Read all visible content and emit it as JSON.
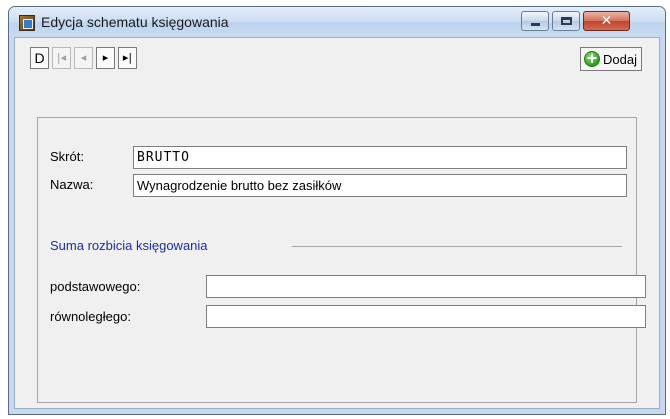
{
  "window": {
    "title": "Edycja schematu księgowania",
    "icon": "app-icon",
    "caption_buttons": {
      "minimize": "minimize-icon",
      "maximize": "maximize-icon",
      "close": "close-icon",
      "close_glyph": "✕"
    }
  },
  "toolbar": {
    "nav": {
      "d_label": "D",
      "first_glyph": "|◂",
      "prev_glyph": "◂",
      "next_glyph": "▸",
      "last_glyph": "▸|"
    },
    "add_label": "Dodaj",
    "add_icon_glyph": "+"
  },
  "form": {
    "skrot_label": "Skrót:",
    "skrot_value": "BRUTTO",
    "nazwa_label": "Nazwa:",
    "nazwa_value": "Wynagrodzenie brutto bez zasiłków",
    "group_title": "Suma rozbicia księgowania",
    "podstawowego_label": "podstawowego:",
    "podstawowego_value": "",
    "rownoleglego_label": "równoległego:",
    "rownoleglego_value": ""
  },
  "colors": {
    "group_title": "#1d2e9e",
    "close_button": "#c2432b",
    "frame": "#c6d9f0"
  }
}
